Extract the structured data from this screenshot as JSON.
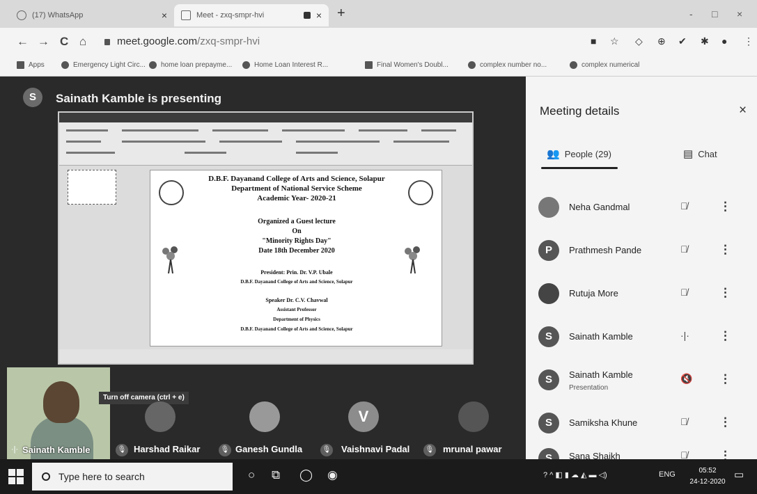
{
  "browser": {
    "tabs": [
      {
        "title": "(17) WhatsApp",
        "close": "×"
      },
      {
        "title": "Meet - zxq-smpr-hvi",
        "close": "×"
      }
    ],
    "new_tab": "+",
    "window_controls": {
      "minimize": "-",
      "maximize": "□",
      "close": "×"
    },
    "nav": {
      "back": "←",
      "forward": "→",
      "reload": "C",
      "home": "⌂"
    },
    "url": {
      "domain": "meet.google.com",
      "path": "/zxq-smpr-hvi"
    },
    "extensions": [
      "■",
      "☆",
      "◇",
      "⊕",
      "✔",
      "✱",
      "●",
      "⋮"
    ],
    "bookmarks": [
      "Apps",
      "Emergency Light Circ...",
      "home loan prepayme...",
      "Home Loan Interest R...",
      "Final Women's Doubl...",
      "complex number no...",
      "complex numerical"
    ]
  },
  "meet": {
    "presenter": {
      "initial": "S",
      "label": "Sainath Kamble is presenting"
    },
    "shared_slide": {
      "lines": [
        "D.B.F. Dayanand College of Arts and Science, Solapur",
        "Department of National Service Scheme",
        "Academic Year- 2020-21",
        "Organized a Guest lecture",
        "On",
        "\"Minority Rights Day\"",
        "Date 18th December 2020",
        "President: Prin. Dr. V.P. Ubale",
        "D.B.F. Dayanand College of Arts and Science, Solapur",
        "Speaker Dr. C.V. Chavwal",
        "Assistant Professor",
        "Department of Physics",
        "D.B.F. Dayanand College of Arts and Science, Solapur"
      ]
    },
    "self_tile": {
      "name": "Sainath Kamble",
      "tooltip": "Turn off camera (ctrl + e)"
    },
    "strip": [
      {
        "name": "Harshad Raikar",
        "initial": ""
      },
      {
        "name": "Ganesh Gundla",
        "initial": ""
      },
      {
        "name": "Vaishnavi Padal",
        "initial": "V"
      },
      {
        "name": "mrunal pawar",
        "initial": ""
      }
    ]
  },
  "panel": {
    "title": "Meeting details",
    "close": "×",
    "tabs": {
      "people": "People (29)",
      "chat": "Chat"
    },
    "people": [
      {
        "name": "Neha Gandmal",
        "sub": "",
        "initial": "",
        "mic": "🎙̸"
      },
      {
        "name": "Prathmesh Pande",
        "sub": "",
        "initial": "P",
        "mic": "🎙̸"
      },
      {
        "name": "Rutuja More",
        "sub": "",
        "initial": "",
        "mic": "🎙̸"
      },
      {
        "name": "Sainath Kamble",
        "sub": "",
        "initial": "S",
        "mic": "·|·"
      },
      {
        "name": "Sainath Kamble",
        "sub": "Presentation",
        "initial": "S",
        "mic": "🔇"
      },
      {
        "name": "Samiksha Khune",
        "sub": "",
        "initial": "S",
        "mic": "🎙̸"
      },
      {
        "name": "Sana Shaikh",
        "sub": "",
        "initial": "S",
        "mic": "🎙̸"
      }
    ]
  },
  "taskbar": {
    "search_placeholder": "Type here to search",
    "tray_lang": "ENG",
    "time": "05:52",
    "date": "24-12-2020"
  },
  "colors": {
    "panel_bg": "#f4f4f4",
    "stage_bg": "#2a2a2a",
    "taskbar_bg": "#1b1b1b"
  }
}
